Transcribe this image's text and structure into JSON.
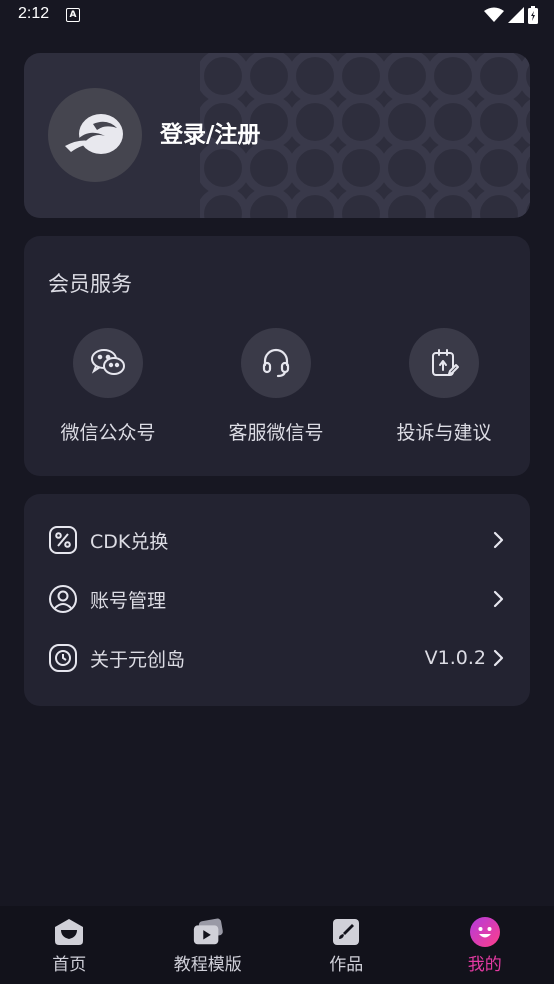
{
  "status": {
    "time": "2:12",
    "badge": "A"
  },
  "profile": {
    "login_label": "登录/注册"
  },
  "member": {
    "title": "会员服务",
    "services": [
      {
        "label": "微信公众号",
        "icon": "wechat-icon"
      },
      {
        "label": "客服微信号",
        "icon": "headset-icon"
      },
      {
        "label": "投诉与建议",
        "icon": "feedback-icon"
      }
    ]
  },
  "settings": {
    "rows": [
      {
        "label": "CDK兑换",
        "icon": "percent-icon",
        "value": ""
      },
      {
        "label": "账号管理",
        "icon": "user-icon",
        "value": ""
      },
      {
        "label": "关于元创岛",
        "icon": "about-icon",
        "value": "V1.0.2"
      }
    ]
  },
  "nav": {
    "items": [
      {
        "label": "首页",
        "icon": "home-icon"
      },
      {
        "label": "教程模版",
        "icon": "tutorial-icon"
      },
      {
        "label": "作品",
        "icon": "works-icon"
      },
      {
        "label": "我的",
        "icon": "profile-icon"
      }
    ],
    "active_index": 3,
    "active_color": "#e33aa2"
  }
}
